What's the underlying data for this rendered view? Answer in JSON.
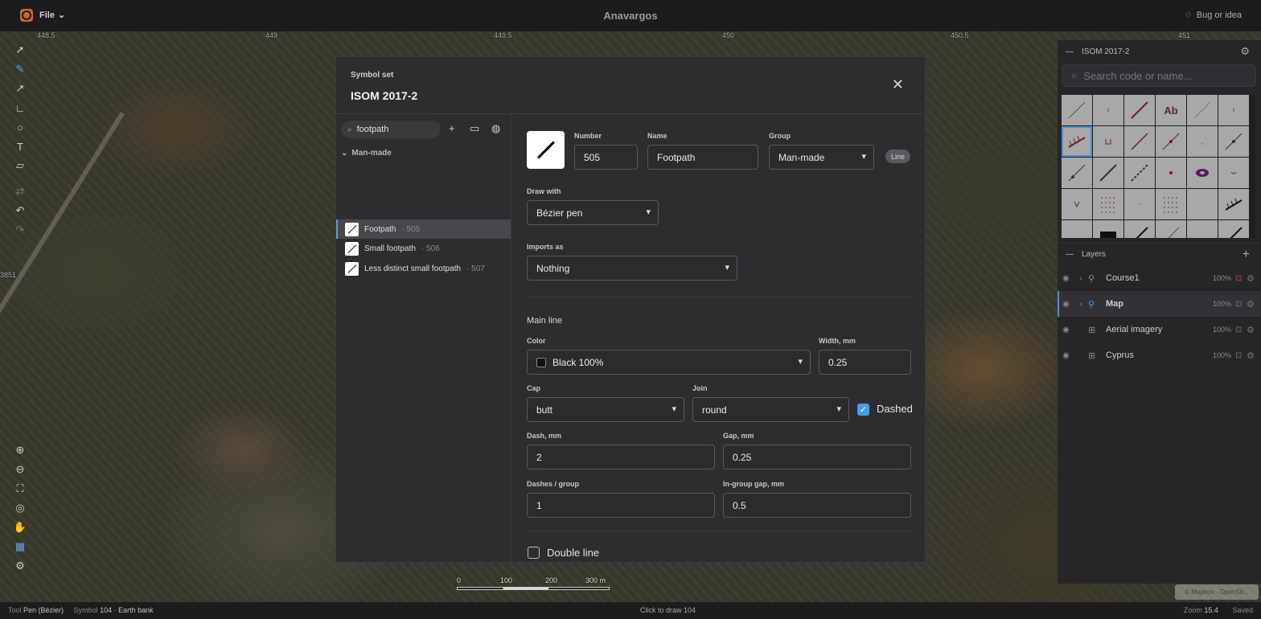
{
  "app": {
    "title": "Anavargos",
    "file_menu": "File",
    "bug_link": "Bug or idea"
  },
  "map": {
    "coords_top": [
      "448.5",
      "449",
      "449.5",
      "450",
      "450.5",
      "451"
    ],
    "coord_left": "3851",
    "scale_labels": [
      "0",
      "100",
      "200",
      "300 m"
    ],
    "credit": "© Mapbox · OpenStr..."
  },
  "modal": {
    "subtitle": "Symbol set",
    "title": "ISOM 2017-2",
    "search_value": "footpath",
    "group_name": "Man-made",
    "symbols": [
      {
        "name": "Footpath",
        "code": "· 505"
      },
      {
        "name": "Small footpath",
        "code": "· 506"
      },
      {
        "name": "Less distinct small footpath",
        "code": "· 507"
      }
    ],
    "labels": {
      "number": "Number",
      "name": "Name",
      "group": "Group",
      "draw_with": "Draw with",
      "imports_as": "Imports as",
      "main_line": "Main line",
      "color": "Color",
      "width": "Width, mm",
      "cap": "Cap",
      "join": "Join",
      "dashed": "Dashed",
      "dash": "Dash, mm",
      "gap": "Gap, mm",
      "dashes_group": "Dashes / group",
      "ingroup_gap": "In-group gap, mm",
      "double_line": "Double line"
    },
    "values": {
      "number": "505",
      "name": "Footpath",
      "group": "Man-made",
      "type_pill": "Line",
      "draw_with": "Bézier pen",
      "imports_as": "Nothing",
      "color": "Black 100%",
      "width": "0.25",
      "cap": "butt",
      "join": "round",
      "dash": "2",
      "gap": "0.25",
      "dashes_group": "1",
      "ingroup_gap": "0.5"
    },
    "dashed_checked": true,
    "double_line_checked": false
  },
  "right_panel": {
    "symbol_set": "ISOM 2017-2",
    "search_placeholder": "Search code or name...",
    "layers_title": "Layers",
    "layers": [
      {
        "name": "Course1",
        "opacity": "100%"
      },
      {
        "name": "Map",
        "opacity": "100%"
      },
      {
        "name": "Aerial imagery",
        "opacity": "100%"
      },
      {
        "name": "Cyprus",
        "opacity": "100%"
      }
    ],
    "grid_text_cell": "Ab"
  },
  "status": {
    "tool_label": "Tool",
    "tool_value": "Pen (Bézier)",
    "symbol_label": "Symbol",
    "symbol_value": "104 · Earth bank",
    "center": "Click to draw 104",
    "zoom_label": "Zoom",
    "zoom_value": "15.4",
    "saved": "Saved"
  },
  "colors": {
    "accent": "#4b9be8",
    "brand": "#d0652f",
    "modal_bg": "#2d2d30",
    "lock_red": "#d34a4a"
  }
}
